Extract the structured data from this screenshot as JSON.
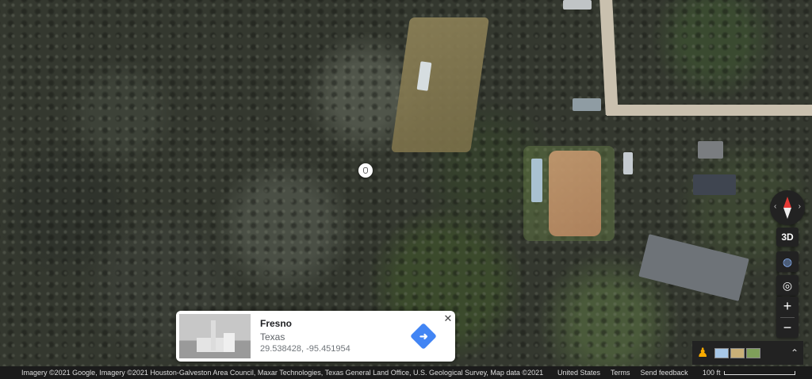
{
  "place_card": {
    "title": "Fresno",
    "subtitle": "Texas",
    "coordinates": "29.538428, -95.451954",
    "close_icon": "close-icon",
    "directions_icon": "directions-icon"
  },
  "controls": {
    "compass_icon": "compass-icon",
    "tilt_label": "3D",
    "globe_icon": "globe-icon",
    "locate_icon": "my-location-icon",
    "zoom_in": "+",
    "zoom_out": "−",
    "pegman_icon": "pegman-icon",
    "expand_icon": "chevron-up-icon"
  },
  "attribution": {
    "text": "Imagery ©2021 Google, Imagery ©2021 Houston-Galveston Area Council, Maxar Technologies, Texas General Land Office, U.S. Geological Survey, Map data ©2021",
    "country": "United States",
    "terms": "Terms",
    "feedback": "Send feedback",
    "scale_label": "100 ft"
  },
  "colors": {
    "directions": "#4285f4",
    "compass_north": "#e53935"
  }
}
